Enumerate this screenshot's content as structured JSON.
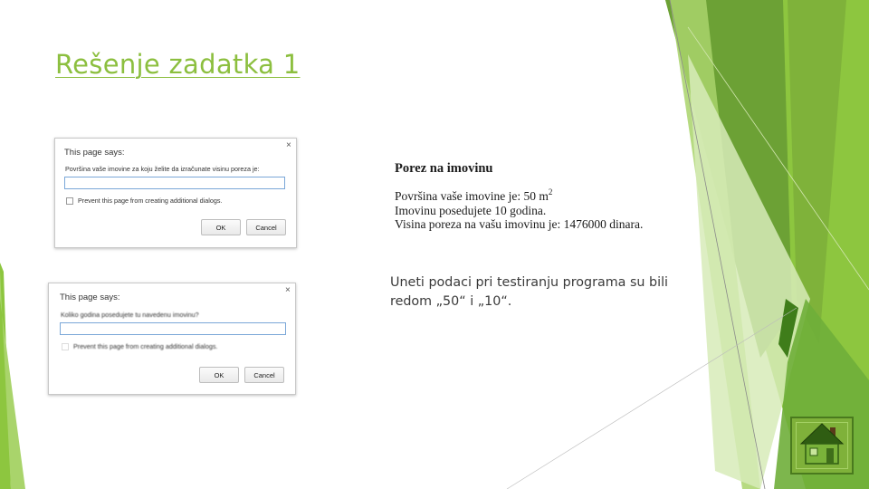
{
  "slide": {
    "title": "Rešenje zadatka 1",
    "note": "Uneti podaci pri testiranju programa su bili redom „50“ i „10“."
  },
  "dialog1": {
    "title": "This page says:",
    "close": "×",
    "prompt": "Površina vaše imovine za koju želite da izračunate visinu poreza je:",
    "input_value": "",
    "checkbox_label": "Prevent this page from creating additional dialogs.",
    "ok": "OK",
    "cancel": "Cancel"
  },
  "dialog2": {
    "title": "This page says:",
    "close": "×",
    "prompt": "Koliko godina posedujete tu navedenu imovinu?",
    "input_value": "",
    "checkbox_label": "Prevent this page from creating additional dialogs.",
    "ok": "OK",
    "cancel": "Cancel"
  },
  "result": {
    "heading": "Porez na imovinu",
    "line1_prefix": "Površina vaše imovine je: 50 m",
    "line1_sup": "2",
    "line2": "Imovinu posedujete 10 godina.",
    "line3": "Visina poreza na vašu imovinu je: 1476000 dinara."
  },
  "colors": {
    "accent": "#8cbf3f",
    "green_dark": "#4f8a20",
    "green_mid": "#7db33a",
    "green_light": "#cfe5ad"
  },
  "icons": {
    "home": "home-icon"
  }
}
